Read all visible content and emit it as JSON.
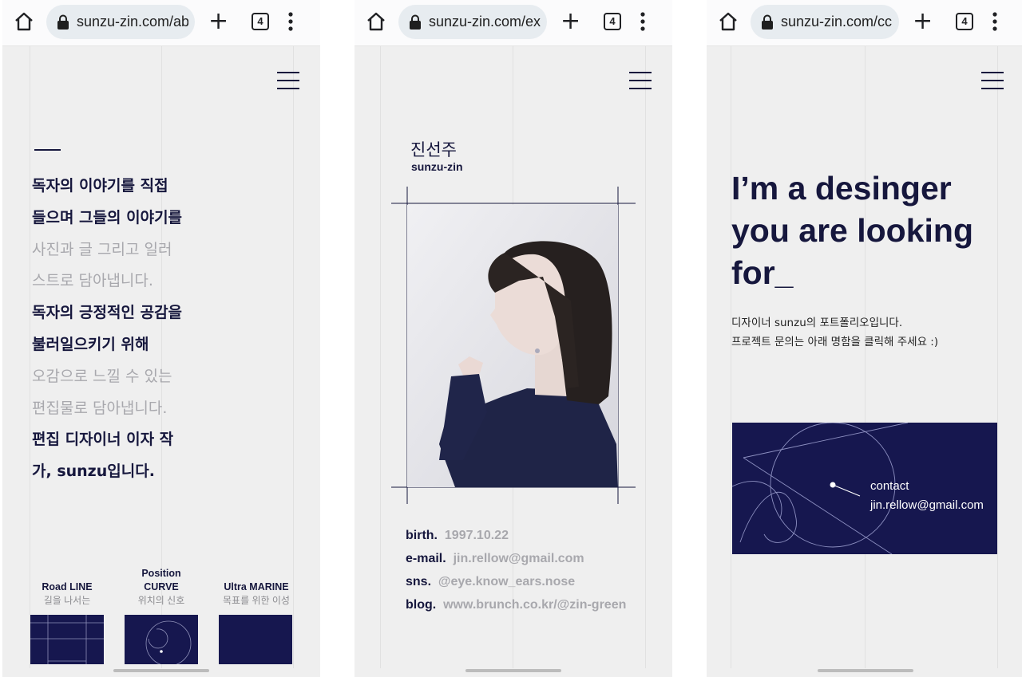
{
  "phones": [
    {
      "url": "sunzu-zin.com/ab",
      "tab_count": "4"
    },
    {
      "url": "sunzu-zin.com/ex",
      "tab_count": "4"
    },
    {
      "url": "sunzu-zin.com/cc",
      "tab_count": "4"
    }
  ],
  "about": {
    "lines": [
      {
        "text": "독자의 이야기를 직접",
        "tone": "dark"
      },
      {
        "text": "들으며 그들의 이야기를",
        "tone": "dark"
      },
      {
        "text": "사진과 글 그리고 일러",
        "tone": "light"
      },
      {
        "text": "스트로 담아냅니다.",
        "tone": "light"
      },
      {
        "text": "독자의 긍정적인 공감을",
        "tone": "dark"
      },
      {
        "text": "불러일으키기 위해",
        "tone": "dark"
      },
      {
        "text": "오감으로 느낄 수 있는",
        "tone": "light"
      },
      {
        "text": "편집물로 담아냅니다.",
        "tone": "light"
      },
      {
        "text": "편집 디자이너 이자 작",
        "tone": "dark"
      },
      {
        "text": "가, sunzu입니다.",
        "tone": "dark"
      }
    ],
    "categories": [
      {
        "title": "Road LINE",
        "subtitle": "길을 나서는"
      },
      {
        "title_line1": "Position",
        "title_line2": "CURVE",
        "subtitle": "위치의 신호"
      },
      {
        "title": "Ultra MARINE",
        "subtitle": "목표를 위한 이성"
      }
    ]
  },
  "profile": {
    "name_ko": "진선주",
    "name_en": "sunzu-zin",
    "fields": [
      {
        "label": "birth.",
        "value": "1997.10.22"
      },
      {
        "label": "e-mail.",
        "value": "jin.rellow@gmail.com"
      },
      {
        "label": "sns.",
        "value": "@eye.know_ears.nose"
      },
      {
        "label": "blog.",
        "value": "www.brunch.co.kr/@zin-green"
      }
    ]
  },
  "contact": {
    "hero_lines": [
      "I’m a desinger",
      "you are looking",
      "for_"
    ],
    "desc_lines": [
      "디자이너 sunzu의 포트폴리오입니다.",
      "프로젝트 문의는 아래 명함을 클릭해 주세요 :)"
    ],
    "card_label": "contact",
    "card_email": "jin.rellow@gmail.com"
  },
  "colors": {
    "navy": "#16173d",
    "card_navy": "#16174f",
    "muted": "#a8a8ad"
  }
}
